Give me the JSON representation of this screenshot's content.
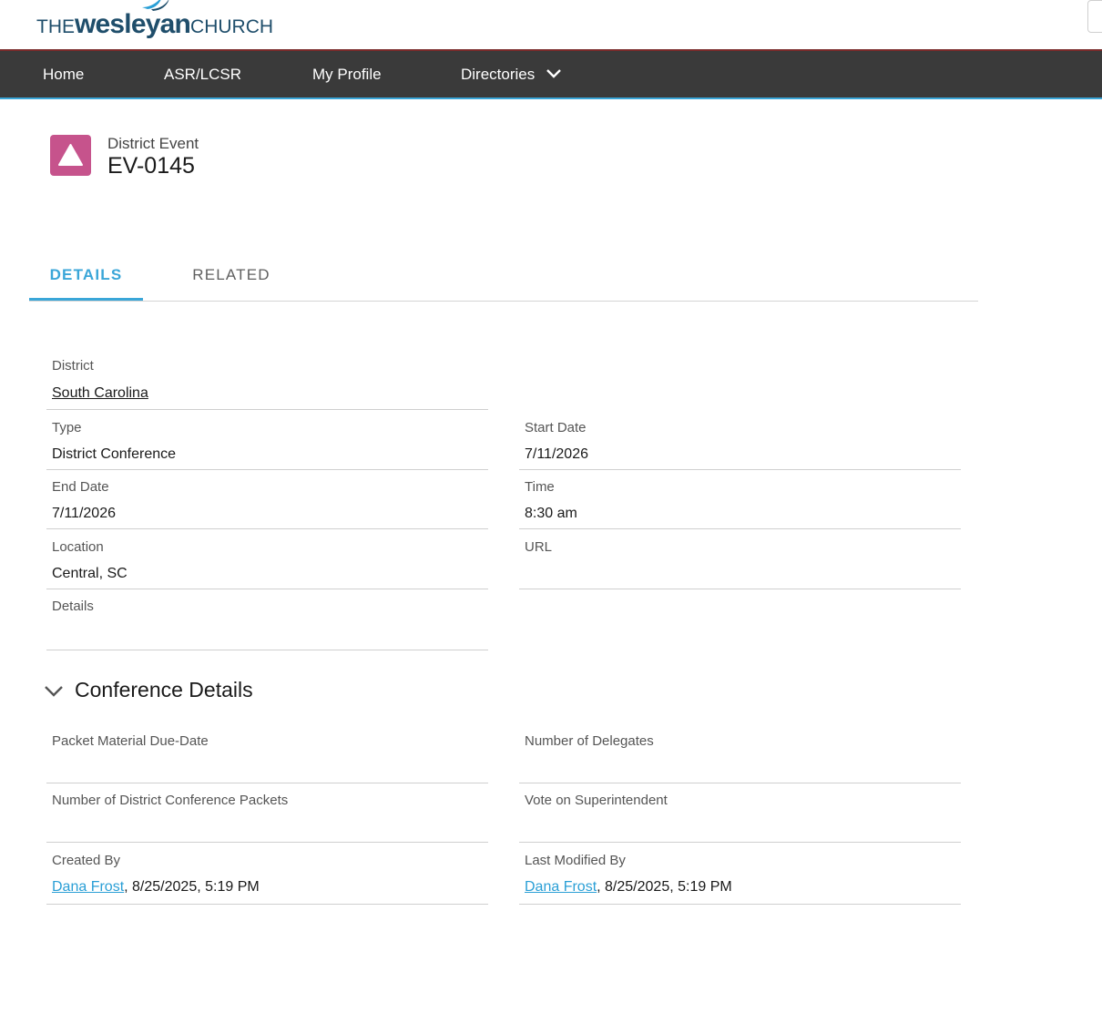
{
  "brand": {
    "the": "THE",
    "wesleyan": "wesleyan",
    "church": "CHURCH",
    "color": "#1f4e6b"
  },
  "nav": {
    "items": [
      {
        "label": "Home"
      },
      {
        "label": "ASR/LCSR"
      },
      {
        "label": "My Profile"
      },
      {
        "label": "Directories"
      }
    ],
    "bg": "#3a3a3a",
    "accent": "#3aa6d8"
  },
  "record": {
    "type": "District Event",
    "name": "EV-0145",
    "icon": "triangle-icon",
    "icon_color": "#c6538c"
  },
  "tabs": [
    {
      "label": "DETAILS",
      "active": true
    },
    {
      "label": "RELATED",
      "active": false
    }
  ],
  "fields": {
    "district": {
      "label": "District",
      "value": "South Carolina"
    },
    "type": {
      "label": "Type",
      "value": "District Conference"
    },
    "start_date": {
      "label": "Start Date",
      "value": "7/11/2026"
    },
    "end_date": {
      "label": "End Date",
      "value": "7/11/2026"
    },
    "time": {
      "label": "Time",
      "value": "8:30 am"
    },
    "location": {
      "label": "Location",
      "value": "Central, SC"
    },
    "url": {
      "label": "URL",
      "value": ""
    },
    "details": {
      "label": "Details",
      "value": ""
    }
  },
  "conference": {
    "title": "Conference Details",
    "packet_due": {
      "label": "Packet Material Due-Date",
      "value": ""
    },
    "delegates": {
      "label": "Number of Delegates",
      "value": ""
    },
    "packets": {
      "label": "Number of District Conference Packets",
      "value": ""
    },
    "vote": {
      "label": "Vote on Superintendent",
      "value": ""
    },
    "created_by": {
      "label": "Created By",
      "user": "Dana Frost",
      "date": ", 8/25/2025, 5:19 PM"
    },
    "modified_by": {
      "label": "Last Modified By",
      "user": "Dana Frost",
      "date": ", 8/25/2025, 5:19 PM"
    }
  }
}
